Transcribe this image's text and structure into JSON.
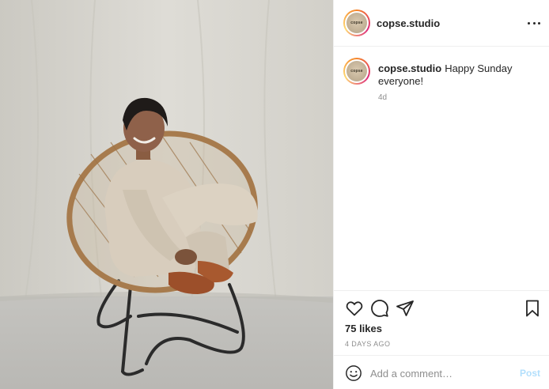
{
  "post": {
    "image_alt": "Woman in a beige suit sitting cross-legged in a round rattan chair",
    "header": {
      "username": "copse.studio",
      "avatar_text": "copse"
    },
    "caption": {
      "username": "copse.studio",
      "text": "Happy Sunday everyone!",
      "time_ago": "4d"
    },
    "likes": "75 likes",
    "date": "4 DAYS AGO",
    "comment_box": {
      "placeholder": "Add a comment…",
      "post_label": "Post"
    }
  },
  "colors": {
    "link_disabled": "#b2dffc",
    "muted": "#8e8e8e",
    "text": "#262626",
    "divider": "#efefef"
  },
  "icons": [
    "more-icon",
    "heart-icon",
    "comment-icon",
    "share-icon",
    "bookmark-icon",
    "emoji-icon"
  ]
}
